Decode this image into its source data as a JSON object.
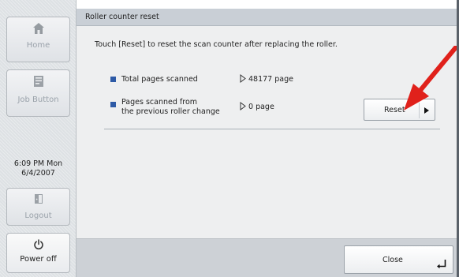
{
  "sidebar": {
    "home_label": "Home",
    "job_label": "Job Button",
    "clock_time": "6:09 PM  Mon",
    "clock_date": "6/4/2007",
    "logout_label": "Logout",
    "power_label": "Power off"
  },
  "header": {
    "title": "Roller counter reset"
  },
  "main": {
    "instruction": "Touch [Reset] to reset the scan counter after replacing the roller.",
    "rows": [
      {
        "label": "Total pages scanned",
        "value": "48177 page"
      },
      {
        "label_line1": "Pages scanned from",
        "label_line2": "the previous roller change",
        "value": "0 page"
      }
    ],
    "reset_label": "Reset"
  },
  "footer": {
    "close_label": "Close"
  },
  "colors": {
    "bullet": "#2d5aa6",
    "annotation_arrow": "#e0211b"
  }
}
